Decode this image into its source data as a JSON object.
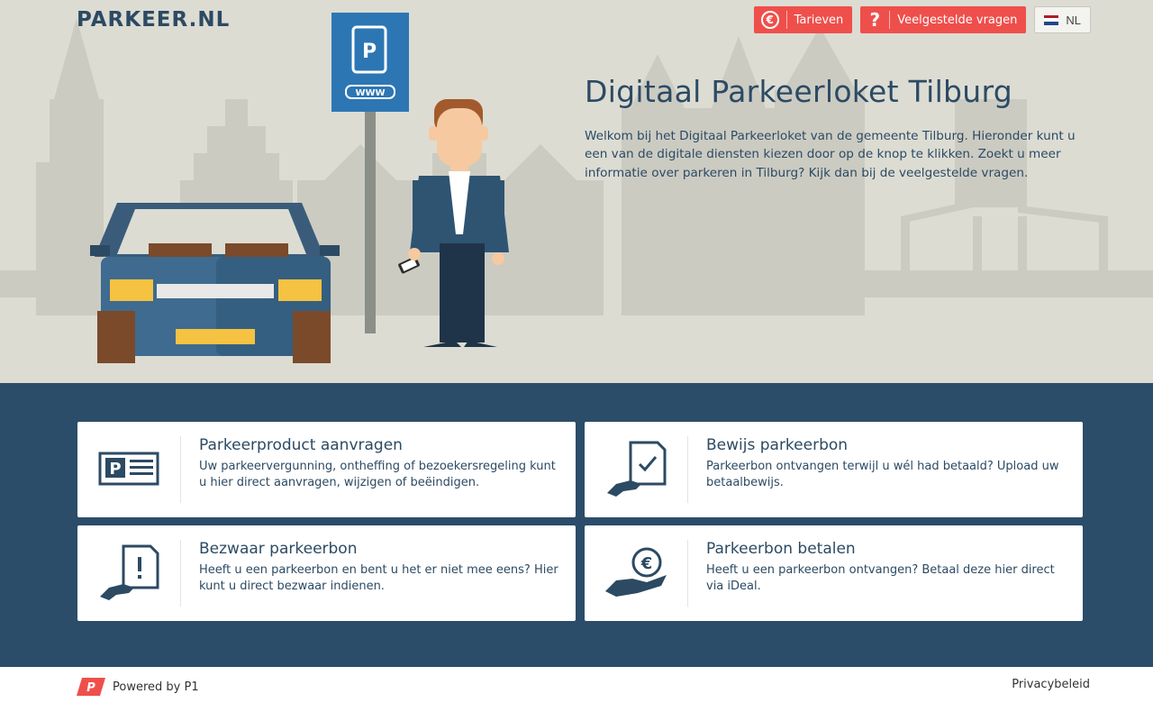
{
  "header": {
    "logo": "PARKEER.NL",
    "tarieven_label": "Tarieven",
    "faq_label": "Veelgestelde vragen",
    "language_label": "NL",
    "euro_glyph": "€",
    "question_glyph": "?"
  },
  "hero": {
    "title": "Digitaal Parkeerloket Tilburg",
    "text": "Welkom bij het Digitaal Parkeerloket van de gemeente Tilburg. Hieronder kunt u een van de digitale diensten kiezen door op de knop te klikken. Zoekt u meer informatie over parkeren in Tilburg? Kijk dan bij de veelgestelde vragen.",
    "sign_label": "WWW"
  },
  "tiles": [
    {
      "title": "Parkeerproduct aanvragen",
      "description": "Uw parkeervergunning, ontheffing of bezoekersregeling kunt u hier direct aanvragen, wijzigen of beëindigen.",
      "icon": "parking-card-icon"
    },
    {
      "title": "Bewijs parkeerbon",
      "description": "Parkeerbon ontvangen terwijl u wél had betaald? Upload uw betaalbewijs.",
      "icon": "document-check-icon"
    },
    {
      "title": "Bezwaar parkeerbon",
      "description": "Heeft u een parkeerbon en bent u het er niet mee eens? Hier kunt u direct bezwaar indienen.",
      "icon": "document-alert-icon"
    },
    {
      "title": "Parkeerbon betalen",
      "description": "Heeft u een parkeerbon ontvangen? Betaal deze hier direct via iDeal.",
      "icon": "hand-euro-icon"
    }
  ],
  "footer": {
    "powered_by": "Powered by P1",
    "privacy": "Privacybeleid"
  },
  "colors": {
    "brand_dark": "#2c4a63",
    "section_bg": "#2b4d69",
    "accent_red": "#ef4f4b",
    "hero_bg": "#dcdcd3"
  }
}
